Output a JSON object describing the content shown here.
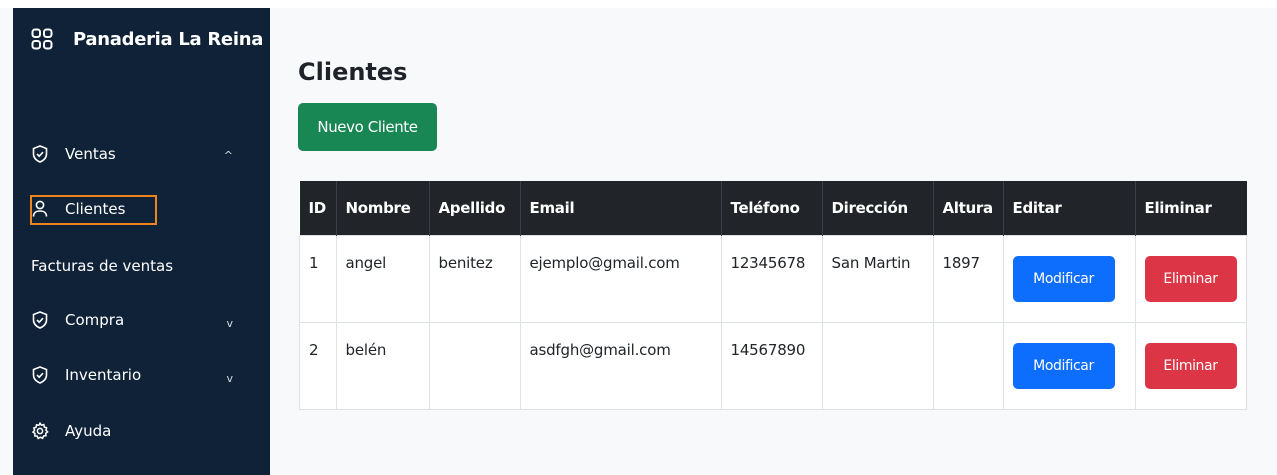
{
  "sidebar": {
    "brand": "Panaderia La Reina",
    "brand_icon": "grid-icon",
    "items": [
      {
        "label": "Ventas",
        "icon": "shield-check-icon",
        "chevron": "^"
      },
      {
        "label": "Clientes",
        "icon": "user-icon",
        "active": true
      },
      {
        "label": "Facturas de ventas"
      },
      {
        "label": "Compra",
        "icon": "shield-check-icon",
        "chevron": "v"
      },
      {
        "label": "Inventario",
        "icon": "shield-check-icon",
        "chevron": "v"
      },
      {
        "label": "Ayuda",
        "icon": "gear-icon"
      }
    ]
  },
  "main": {
    "title": "Clientes",
    "new_button": "Nuevo Cliente",
    "table": {
      "headers": [
        "ID",
        "Nombre",
        "Apellido",
        "Email",
        "Teléfono",
        "Dirección",
        "Altura",
        "Editar",
        "Eliminar"
      ],
      "rows": [
        {
          "id": "1",
          "nombre": "angel",
          "apellido": "benitez",
          "email": "ejemplo@gmail.com",
          "telefono": "12345678",
          "direccion": "San Martin",
          "altura": "1897",
          "edit": "Modificar",
          "delete": "Eliminar"
        },
        {
          "id": "2",
          "nombre": "belén",
          "apellido": "",
          "email": "asdfgh@gmail.com",
          "telefono": "14567890",
          "direccion": "",
          "altura": "",
          "edit": "Modificar",
          "delete": "Eliminar"
        }
      ]
    }
  },
  "colors": {
    "sidebar_bg": "#0f2237",
    "active_outline": "#f0841c",
    "success": "#198754",
    "primary": "#0d6efd",
    "danger": "#dc3545",
    "table_header": "#212529"
  }
}
